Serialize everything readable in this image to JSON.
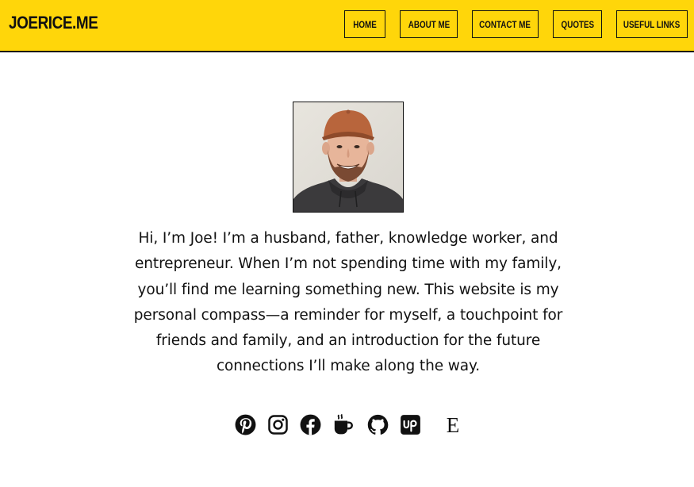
{
  "header": {
    "logo": "JOERICE.ME",
    "background": "#FFD60A",
    "nav": [
      {
        "label": "HOME"
      },
      {
        "label": "ABOUT ME"
      },
      {
        "label": "CONTACT ME"
      },
      {
        "label": "QUOTES"
      },
      {
        "label": "USEFUL LINKS"
      }
    ]
  },
  "profile": {
    "bio": "Hi, I’m Joe! I’m a husband, father, knowledge worker, and entrepreneur. When I’m not spending time with my family, you’ll find me learning something new. This website is my personal compass—a reminder for myself, a touchpoint for friends and family, and an introduction for the future connections I’ll make along the way."
  },
  "social": [
    {
      "icon": "pinterest-icon"
    },
    {
      "icon": "instagram-icon"
    },
    {
      "icon": "facebook-icon"
    },
    {
      "icon": "coffee-cup-icon"
    },
    {
      "icon": "github-icon"
    },
    {
      "icon": "upwork-icon"
    },
    {
      "icon": "etsy-icon",
      "glyph": "E"
    }
  ]
}
